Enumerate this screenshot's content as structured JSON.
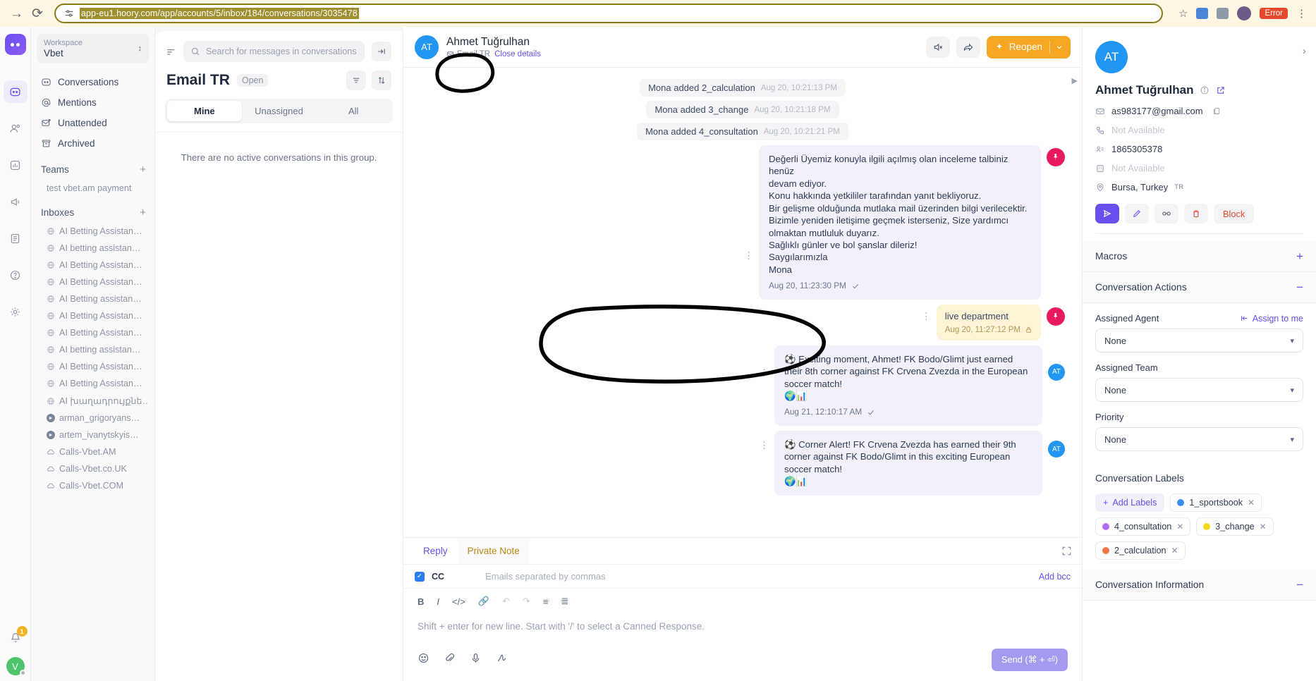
{
  "browser": {
    "url": "app-eu1.hoory.com/app/accounts/5/inbox/184/conversations/3035478",
    "forward_icon": "forward-arrow-icon",
    "reload_icon": "reload-icon",
    "site_settings_icon": "site-settings-icon",
    "bookmark_icon": "star-icon",
    "error_label": "Error",
    "menu_icon": "kebab-menu-icon"
  },
  "rail": {
    "logo": "hoory-logo",
    "items": [
      {
        "name": "conversations-rail-icon",
        "active": true
      },
      {
        "name": "contacts-rail-icon",
        "active": false
      },
      {
        "name": "reports-rail-icon",
        "active": false
      },
      {
        "name": "campaigns-rail-icon",
        "active": false
      },
      {
        "name": "knowledge-base-rail-icon",
        "active": false
      },
      {
        "name": "help-rail-icon",
        "active": false
      },
      {
        "name": "settings-rail-icon",
        "active": false
      }
    ],
    "notification_count": "1",
    "user_initial": "V"
  },
  "sidebar": {
    "workspace_label": "Workspace",
    "workspace_name": "Vbet",
    "nav": [
      {
        "label": "Conversations",
        "icon": "conversations-icon"
      },
      {
        "label": "Mentions",
        "icon": "mention-icon"
      },
      {
        "label": "Unattended",
        "icon": "unattended-envelope-icon"
      },
      {
        "label": "Archived",
        "icon": "archive-icon"
      }
    ],
    "teams_header": "Teams",
    "teams": [
      "test vbet.am payment"
    ],
    "inboxes_header": "Inboxes",
    "inboxes": [
      {
        "label": "AI Betting Assistan…",
        "icon": "globe-icon"
      },
      {
        "label": "AI betting assistan…",
        "icon": "globe-icon"
      },
      {
        "label": "AI Betting Assistan…",
        "icon": "globe-icon"
      },
      {
        "label": "AI Betting Assistan…",
        "icon": "globe-icon"
      },
      {
        "label": "AI Betting assistan…",
        "icon": "globe-icon"
      },
      {
        "label": "AI Betting Assistan…",
        "icon": "globe-icon"
      },
      {
        "label": "AI Betting Assistan…",
        "icon": "globe-icon"
      },
      {
        "label": "AI betting assistan…",
        "icon": "globe-icon"
      },
      {
        "label": "AI Betting Assistan…",
        "icon": "globe-icon"
      },
      {
        "label": "AI Betting Assistan…",
        "icon": "globe-icon"
      },
      {
        "label": "AI խաղադրույքնե…",
        "icon": "globe-icon"
      },
      {
        "label": "arman_grigoryans…",
        "icon": "telegram-icon"
      },
      {
        "label": "artem_ivanytskyis…",
        "icon": "telegram-icon"
      },
      {
        "label": "Calls-Vbet.AM",
        "icon": "cloud-icon"
      },
      {
        "label": "Calls-Vbet.co.UK",
        "icon": "cloud-icon"
      },
      {
        "label": "Calls-Vbet.COM",
        "icon": "cloud-icon"
      }
    ]
  },
  "conv_list": {
    "search_placeholder": "Search for messages in conversations",
    "sort_icon": "sort-lines-icon",
    "collapse_icon": "collapse-panel-icon",
    "title": "Email TR",
    "status": "Open",
    "filter_icon": "filter-icon",
    "order_icon": "sort-updown-icon",
    "tabs": [
      {
        "label": "Mine",
        "active": true
      },
      {
        "label": "Unassigned",
        "active": false
      },
      {
        "label": "All",
        "active": false
      }
    ],
    "empty_text": "There are no active conversations in this group."
  },
  "chat": {
    "avatar_initials": "AT",
    "contact_name": "Ahmet Tuğrulhan",
    "inbox_name": "Email TR",
    "inbox_icon": "envelope-icon",
    "close_details": "Close details",
    "mute_icon": "mute-speaker-icon",
    "share_icon": "share-arrow-icon",
    "reopen_label": "Reopen",
    "reopen_icon": "sparkle-icon",
    "reopen_caret": "chevron-down-icon",
    "reopen_color": "#f5a623",
    "system_events": [
      {
        "text": "Mona added 2_calculation",
        "time": "Aug 20, 10:21:13 PM"
      },
      {
        "text": "Mona added 3_change",
        "time": "Aug 20, 10:21:18 PM"
      },
      {
        "text": "Mona added 4_consultation",
        "time": "Aug 20, 10:21:21 PM"
      }
    ],
    "messages": [
      {
        "type": "agent",
        "lines": [
          "Değerli Üyemiz konuyla ilgili açılmış olan inceleme talbiniz henüz",
          "devam ediyor.",
          "Konu hakkında yetkililer tarafından yanıt bekliyoruz.",
          "Bir gelişme olduğunda mutlaka mail üzerinden bilgi verilecektir.",
          "Bizimle yeniden iletişime geçmek isterseniz, Size yardımcı",
          "olmaktan mutluluk duyarız.",
          "Sağlıklı günler ve bol şanslar dileriz!",
          "Saygılarımızla",
          "Mona"
        ],
        "time": "Aug 20, 11:23:30 PM",
        "status_icon": "sent-check-icon"
      },
      {
        "type": "private-note",
        "text": "live department",
        "time": "Aug 20, 11:27:12 PM",
        "status_icon": "lock-icon"
      },
      {
        "type": "agent",
        "emoji": "⚽",
        "lines": [
          "Exciting moment, Ahmet! FK Bodo/Glimt just earned their 8th",
          "corner against FK Crvena Zvezda in the European soccer match!"
        ],
        "trailing_emoji": "🌍📊",
        "time": "Aug 21, 12:10:17 AM",
        "status_icon": "sent-check-icon"
      },
      {
        "type": "agent",
        "emoji": "⚽",
        "lines": [
          "Corner Alert! FK Crvena Zvezda has earned their 9th corner",
          "against FK Bodo/Glimt in this exciting European soccer match!"
        ],
        "trailing_emoji": "🌍📊"
      }
    ]
  },
  "composer": {
    "tabs": [
      {
        "label": "Reply",
        "active": true
      },
      {
        "label": "Private Note",
        "active": false
      }
    ],
    "expand_icon": "expand-editor-icon",
    "cc_label": "CC",
    "cc_placeholder": "Emails separated by commas",
    "cc_checked": true,
    "add_bcc": "Add bcc",
    "format_icons": [
      "bold-icon",
      "italic-icon",
      "code-icon",
      "link-icon",
      "undo-icon",
      "redo-icon",
      "bullet-list-icon",
      "numbered-list-icon"
    ],
    "placeholder": "Shift + enter for new line. Start with '/' to select a Canned Response.",
    "foot_icons": [
      "emoji-icon",
      "attachment-icon",
      "microphone-icon",
      "signature-icon"
    ],
    "send_label": "Send (⌘ + ⏎)"
  },
  "contact": {
    "avatar_initials": "AT",
    "name": "Ahmet Tuğrulhan",
    "info_icon": "info-circle-icon",
    "open_icon": "open-external-icon",
    "expand_icon": "chevron-right-icon",
    "email": "as983177@gmail.com",
    "email_icon": "envelope-icon",
    "copy_icon": "copy-icon",
    "phone_not_available": "Not Available",
    "phone_icon": "phone-icon",
    "id_value": "1865305378",
    "id_icon": "identity-icon",
    "company_not_available": "Not Available",
    "company_icon": "building-icon",
    "location": "Bursa, Turkey",
    "location_flag": "TR",
    "location_icon": "map-pin-icon",
    "actions": [
      {
        "name": "send-icon",
        "style": "prim"
      },
      {
        "name": "edit-pencil-icon",
        "style": ""
      },
      {
        "name": "merge-contact-icon",
        "style": ""
      },
      {
        "name": "delete-trash-icon",
        "style": "del"
      }
    ],
    "block_label": "Block",
    "macros_header": "Macros",
    "macros_toggle": "+",
    "actions_header": "Conversation Actions",
    "actions_toggle": "−",
    "assigned_agent_label": "Assigned Agent",
    "assign_to_me": "Assign to me",
    "assign_icon": "assign-to-me-icon",
    "assigned_agent_value": "None",
    "assigned_team_label": "Assigned Team",
    "assigned_team_value": "None",
    "priority_label": "Priority",
    "priority_value": "None",
    "labels_header": "Conversation Labels",
    "add_labels": "Add Labels",
    "labels": [
      {
        "name": "1_sportsbook",
        "color": "#3b8ef0"
      },
      {
        "name": "4_consultation",
        "color": "#b06cf0"
      },
      {
        "name": "3_change",
        "color": "#f5d91f"
      },
      {
        "name": "2_calculation",
        "color": "#f07845"
      }
    ],
    "info_header": "Conversation Information",
    "info_toggle": "−"
  },
  "annotations": [
    {
      "name": "circle-annotation-inbox-name"
    },
    {
      "name": "circle-annotation-message-bubble"
    }
  ]
}
